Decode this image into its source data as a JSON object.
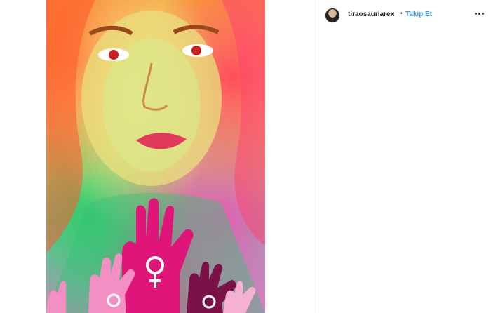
{
  "post": {
    "username": "tiraosauriarex",
    "separator": "•",
    "follow_label": "Takip Et",
    "more_icon": "more-horizontal-icon",
    "avatar_icon": "avatar-icon"
  },
  "colors": {
    "follow": "#3897f0",
    "text": "#262626",
    "hand_magenta": "#e0157a",
    "hand_pink": "#f48fc3",
    "hand_dark": "#7a1247",
    "female_symbol": "#ffffff"
  }
}
